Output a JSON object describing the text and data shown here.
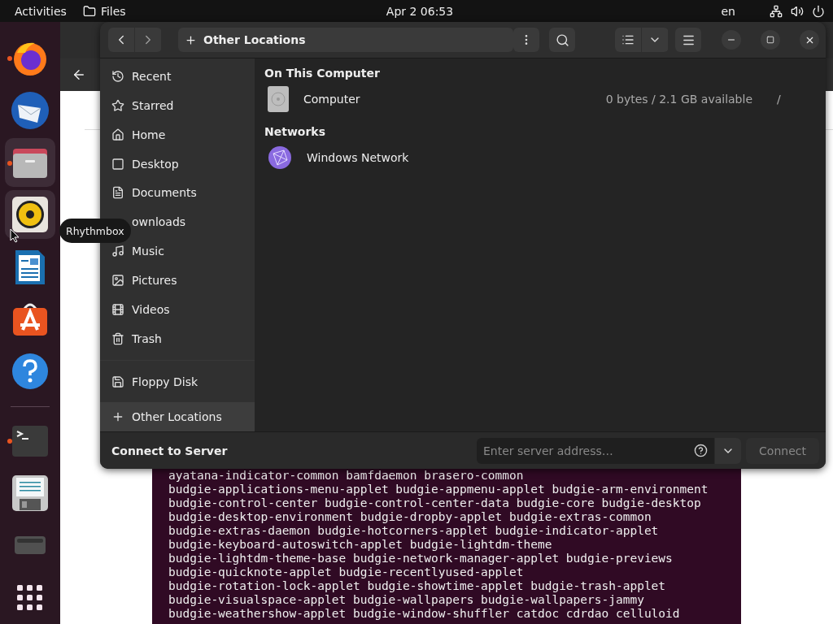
{
  "top_bar": {
    "activities": "Activities",
    "app": "Files",
    "clock": "Apr 2  06:53",
    "language": "en"
  },
  "dock": [
    {
      "kind": "firefox",
      "running": true,
      "highlighted": false
    },
    {
      "kind": "mail",
      "running": false,
      "highlighted": false
    },
    {
      "kind": "files",
      "running": true,
      "highlighted": true
    },
    {
      "kind": "rhythmbox",
      "running": false,
      "highlighted": true
    },
    {
      "kind": "writer",
      "running": false,
      "highlighted": false
    },
    {
      "kind": "appcenter",
      "running": false,
      "highlighted": false
    },
    {
      "kind": "help",
      "running": false,
      "highlighted": false
    },
    {
      "kind": "separator"
    },
    {
      "kind": "terminal",
      "running": true,
      "highlighted": false
    },
    {
      "kind": "floppy",
      "running": false,
      "highlighted": false
    },
    {
      "kind": "drive",
      "running": false,
      "highlighted": false
    },
    {
      "kind": "apps",
      "running": false,
      "highlighted": false
    }
  ],
  "tooltip": "Rhythmbox",
  "files_window": {
    "path": "Other Locations",
    "sidebar": [
      {
        "kind": "recent",
        "label": "Recent",
        "selected": false
      },
      {
        "kind": "starred",
        "label": "Starred",
        "selected": false
      },
      {
        "kind": "home",
        "label": "Home",
        "selected": false
      },
      {
        "kind": "desktop",
        "label": "Desktop",
        "selected": false
      },
      {
        "kind": "documents",
        "label": "Documents",
        "selected": false
      },
      {
        "kind": "covered",
        "label": "ownloads",
        "selected": false
      },
      {
        "kind": "music",
        "label": "Music",
        "selected": false
      },
      {
        "kind": "pictures",
        "label": "Pictures",
        "selected": false
      },
      {
        "kind": "videos",
        "label": "Videos",
        "selected": false
      },
      {
        "kind": "trash",
        "label": "Trash",
        "selected": false
      },
      {
        "kind": "floppy",
        "label": "Floppy Disk",
        "selected": false
      },
      {
        "kind": "other",
        "label": "Other Locations",
        "selected": true
      }
    ],
    "sections": [
      {
        "title": "On This Computer",
        "items": [
          {
            "kind": "drive",
            "name": "Computer",
            "info": "0 bytes / 2.1 GB available",
            "path": "/"
          }
        ]
      },
      {
        "title": "Networks",
        "items": [
          {
            "kind": "network",
            "name": "Windows Network"
          }
        ]
      }
    ],
    "connect": {
      "label": "Connect to Server",
      "placeholder": "Enter server address…",
      "button": "Connect"
    }
  },
  "terminal_lines": [
    "ayatana-indicator-common bamfdaemon brasero-common",
    "budgie-applications-menu-applet budgie-appmenu-applet budgie-arm-environment",
    "budgie-control-center budgie-control-center-data budgie-core budgie-desktop",
    "budgie-desktop-environment budgie-dropby-applet budgie-extras-common",
    "budgie-extras-daemon budgie-hotcorners-applet budgie-indicator-applet",
    "budgie-keyboard-autoswitch-applet budgie-lightdm-theme",
    "budgie-lightdm-theme-base budgie-network-manager-applet budgie-previews",
    "budgie-quicknote-applet budgie-recentlyused-applet",
    "budgie-rotation-lock-applet budgie-showtime-applet budgie-trash-applet",
    "budgie-visualspace-applet budgie-wallpapers budgie-wallpapers-jammy",
    "budgie-weathershow-applet budgie-window-shuffler catdoc cdrdao celluloid"
  ]
}
